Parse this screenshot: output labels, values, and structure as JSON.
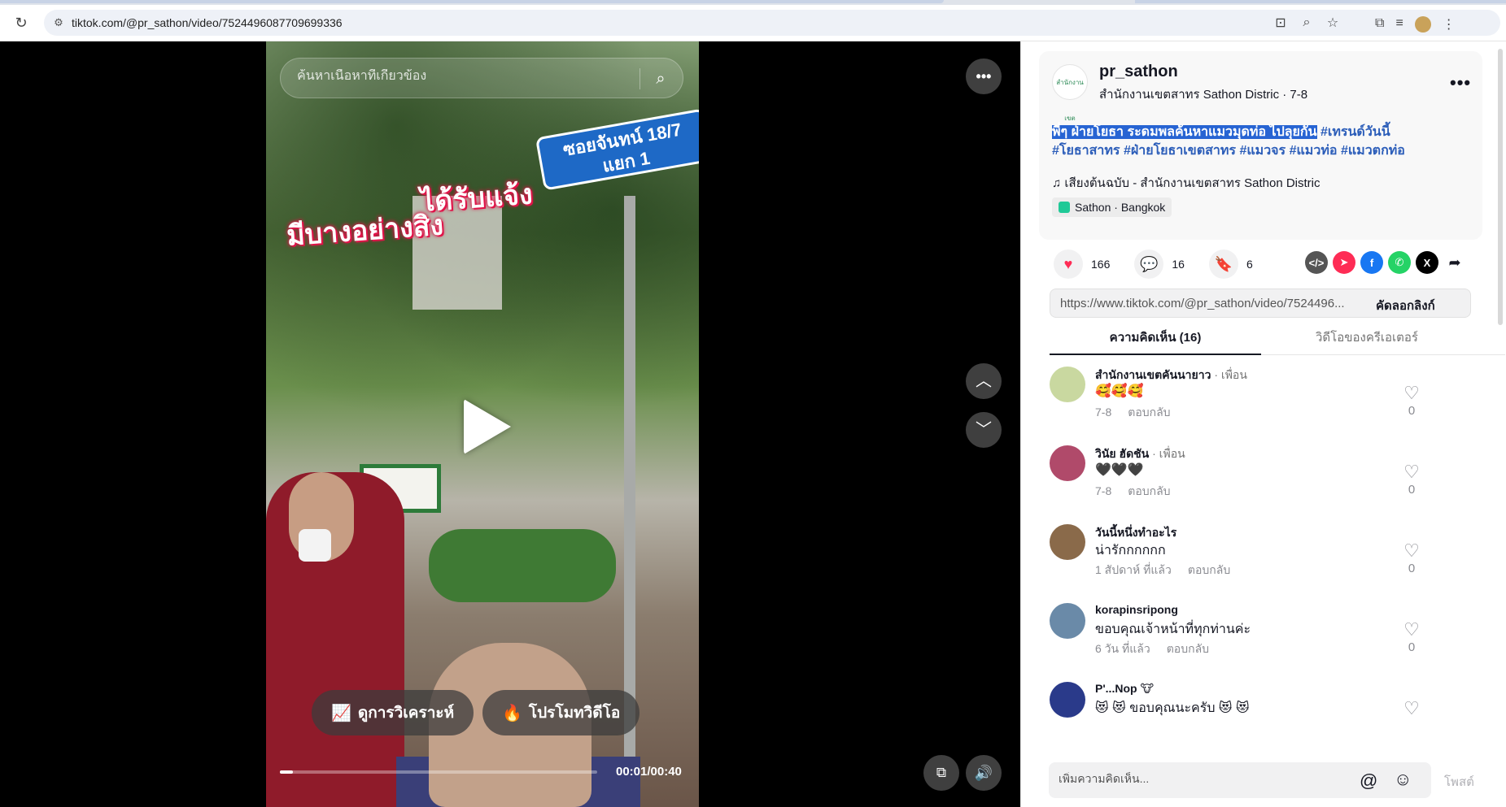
{
  "browser": {
    "url": "tiktok.com/@pr_sathon/video/7524496087709699336"
  },
  "video": {
    "search_placeholder": "ค้นหาเนื้อหาที่เกี่ยวข้อง",
    "street_sign_line1": "ซอยจันทน์ 18/7",
    "street_sign_line2": "แยก 1",
    "caption_line1": "ได้รับแจ้ง",
    "caption_line2": "มีบางอย่างสิง",
    "analytics_button": "ดูการวิเคราะห์",
    "promote_button": "โปรโมทวิดีโอ",
    "time": "00:01/00:40",
    "progress": 0.04
  },
  "post": {
    "author_username": "pr_sathon",
    "author_avatar_text": "สำนักงานเขต",
    "author_display": "สำนักงานเขตสาทร Sathon Distric · 7-8",
    "description_highlight": "พี่ๆ ฝ่ายโยธา ระดมพลค้นหาแมวมุดท่อ ไปลุยกัน",
    "description_tags_line1": " #เทรนด์วันนี้",
    "description_tags_line2": "#โยธาสาทร #ฝ่ายโยธาเขตสาทร #แมวจร #แมวท่อ #แมวตกท่อ",
    "music": "เสียงต้นฉบับ - สำนักงานเขตสาทร Sathon Distric",
    "location": "Sathon · Bangkok",
    "likes": "166",
    "comments": "16",
    "saves": "6",
    "link": "https://www.tiktok.com/@pr_sathon/video/7524496...",
    "copy_link": "คัดลอกลิงก์"
  },
  "tabs": {
    "comments": "ความคิดเห็น (16)",
    "creator_videos": "วิดีโอของครีเอเตอร์"
  },
  "comments": [
    {
      "name": "สำนักงานเขตคันนายาว",
      "friend": " · เพื่อน",
      "text": "🥰🥰🥰",
      "time": "7-8",
      "reply": "ตอบกลับ",
      "likes": "0",
      "avatar_color": "#c9d8a0"
    },
    {
      "name": "วินัย ฮัดชัน",
      "friend": " · เพื่อน",
      "text": "🖤🖤🖤",
      "time": "7-8",
      "reply": "ตอบกลับ",
      "likes": "0",
      "avatar_color": "#b04a6a"
    },
    {
      "name": "วันนี้หนึ่งทำอะไร",
      "friend": "",
      "text": "น่ารักกกกกก",
      "time": "1 สัปดาห์ ที่แล้ว",
      "reply": "ตอบกลับ",
      "likes": "0",
      "avatar_color": "#8a6a4a"
    },
    {
      "name": "korapinsripong",
      "friend": "",
      "text": "ขอบคุณเจ้าหน้าที่ทุกท่านค่ะ",
      "time": "6 วัน ที่แล้ว",
      "reply": "ตอบกลับ",
      "likes": "0",
      "avatar_color": "#6a8aa8"
    },
    {
      "name": "P'...Nop 🐮",
      "friend": "",
      "text": "😻 😻 ขอบคุณนะครับ 😻 😻",
      "time": "",
      "reply": "",
      "likes": "",
      "avatar_color": "#2a3a8a"
    }
  ],
  "compose": {
    "placeholder": "เพิ่มความคิดเห็น...",
    "post": "โพสต์"
  },
  "colors": {
    "accent_red": "#fe2c55",
    "hashtag_blue": "#2b5db9"
  }
}
